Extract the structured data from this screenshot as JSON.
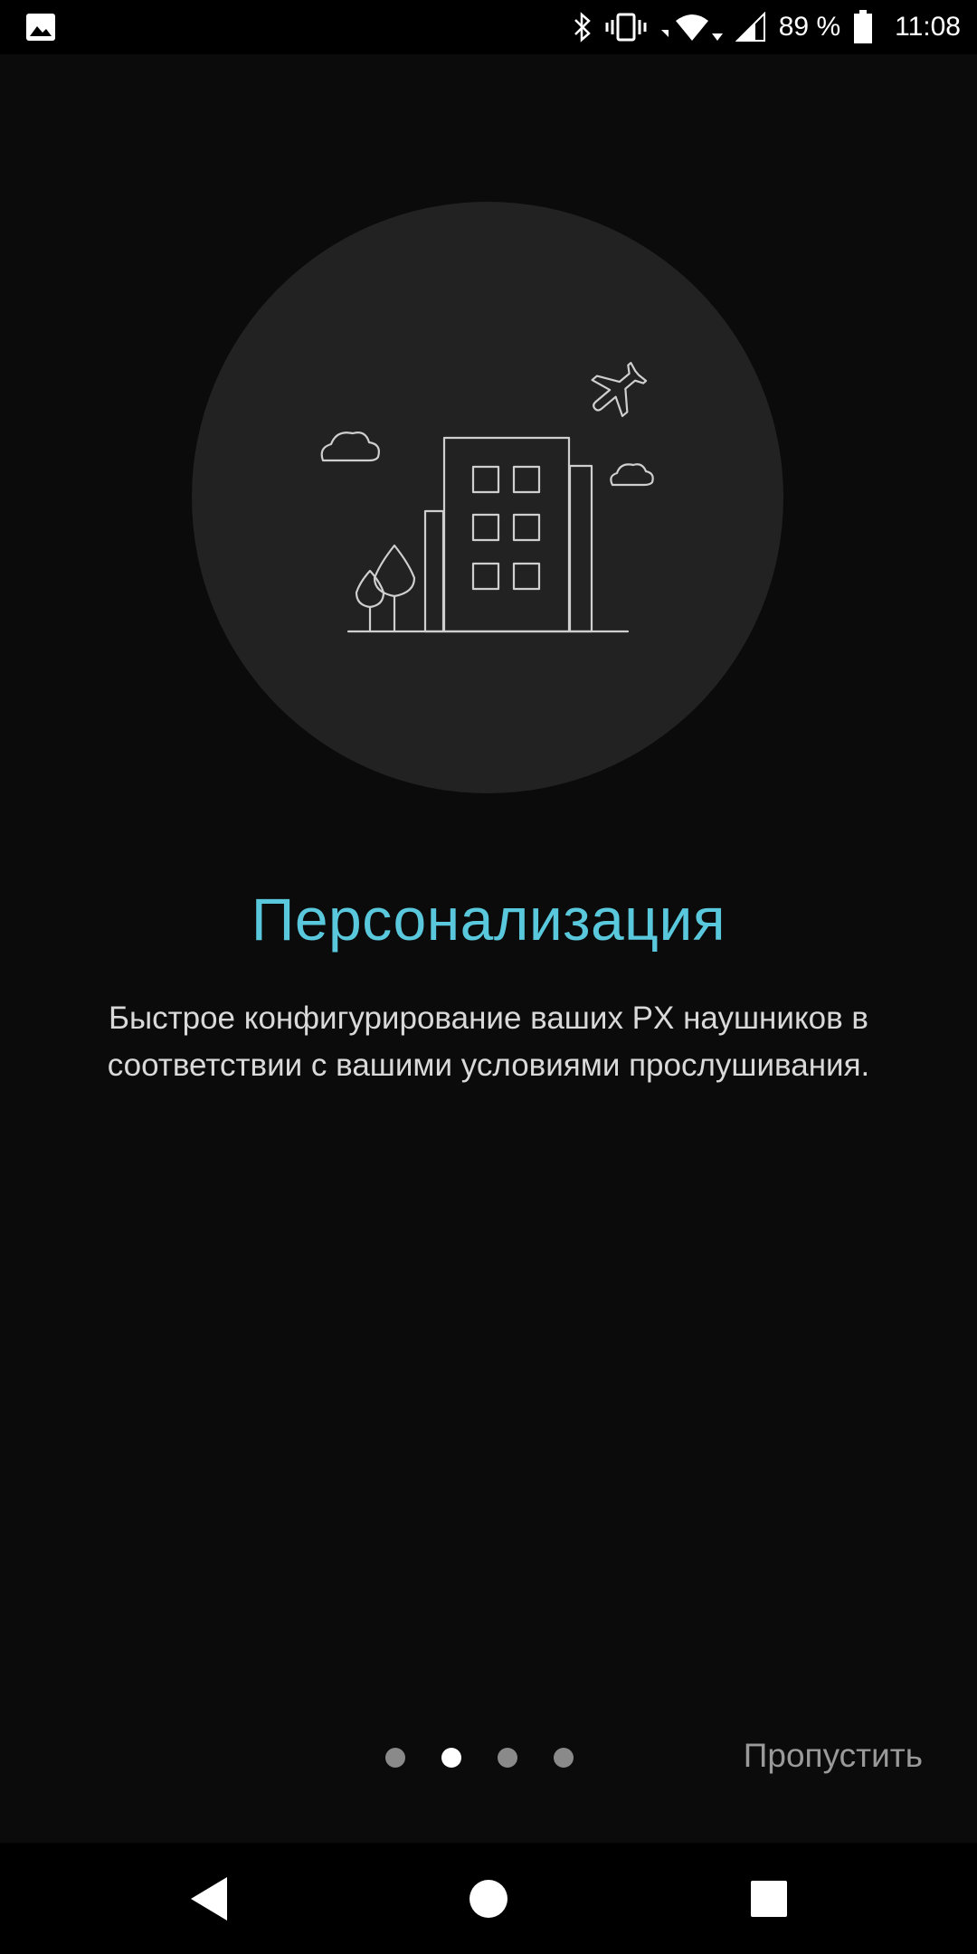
{
  "status_bar": {
    "left_icon": "image-icon",
    "icons": [
      "bluetooth-icon",
      "vibrate-icon",
      "wifi-icon",
      "cell-signal-icon",
      "battery-icon"
    ],
    "battery": "89 %",
    "time": "11:08"
  },
  "illustration": {
    "description_icon": "city-building-illustration",
    "colors": {
      "circle": "#222222",
      "stroke": "#cfcfcf"
    }
  },
  "content": {
    "title": "Персонализация",
    "description": "Быстрое конфигурирование ваших PX наушников в соответствии с вашими условиями прослушивания."
  },
  "pager": {
    "total": 4,
    "active_index": 1
  },
  "skip_label": "Пропустить",
  "nav_bar": {
    "back": "back-icon",
    "home": "home-icon",
    "recents": "recents-icon"
  },
  "colors": {
    "accent": "#5ac8dc",
    "background": "#0b0b0b",
    "text": "#d9d9d9",
    "muted": "#9a9a9a"
  }
}
